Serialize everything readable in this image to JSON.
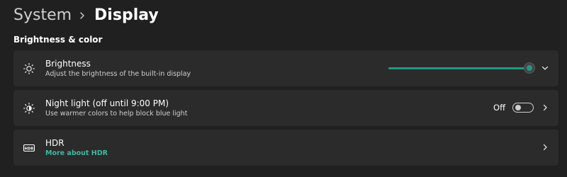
{
  "breadcrumb": {
    "parent": "System",
    "current": "Display"
  },
  "section": {
    "title": "Brightness & color"
  },
  "settings": [
    {
      "icon": "sun-icon",
      "title": "Brightness",
      "subtitle": "Adjust the brightness of the built-in display",
      "control": "slider",
      "brightness_fraction": 0.97
    },
    {
      "icon": "night-light-icon",
      "title": "Night light (off until 9:00 PM)",
      "subtitle": "Use warmer colors to help block blue light",
      "control": "toggle",
      "toggle_state_label": "Off",
      "toggle_on": false
    },
    {
      "icon": "hdr-icon",
      "title": "HDR",
      "subtitle_link": "More about HDR",
      "control": "chevron"
    }
  ],
  "colors": {
    "background": "#202020",
    "card": "#2b2b2b",
    "accent": "#1f9982",
    "link": "#3fb9a2"
  }
}
